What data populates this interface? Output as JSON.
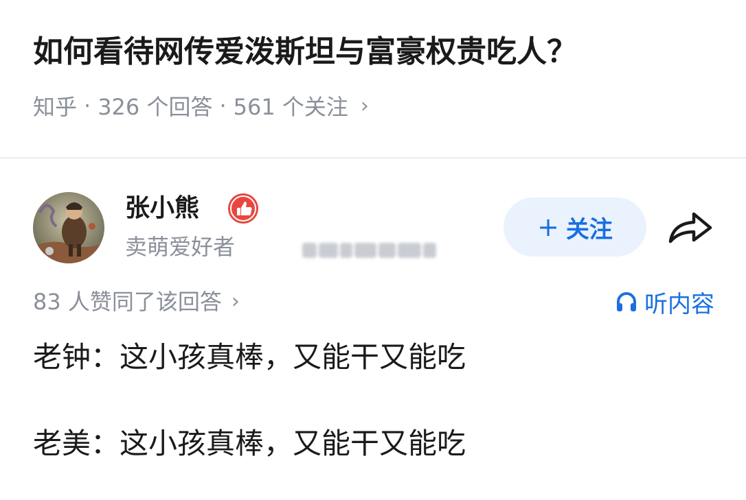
{
  "question": {
    "title": "如何看待网传爱泼斯坦与富豪权贵吃人？",
    "source": "知乎",
    "separator": "·",
    "answers_count": "326 个回答",
    "followers_count": "561 个关注"
  },
  "author": {
    "name": "张小熊",
    "bio": "卖萌爱好者",
    "badge_icon": "thumbs-up-badge-icon",
    "badge_color": "#e8473f"
  },
  "actions": {
    "follow_label": "关注",
    "share_icon": "share-arrow-icon"
  },
  "answer": {
    "upvote_text": "83 人赞同了该回答",
    "listen_label": "听内容",
    "lines": [
      "老钟：这小孩真棒，又能干又能吃",
      "老美：这小孩真棒，又能干又能吃"
    ]
  },
  "colors": {
    "accent": "#1a6fe0",
    "follow_bg": "#eaf2fd",
    "muted_text": "#8a8f99"
  }
}
